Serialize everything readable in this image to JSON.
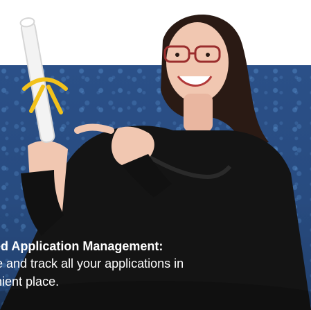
{
  "caption": {
    "title": "zed Application Management:",
    "body_line1": "e and track all your applications in",
    "body_line2": "venient place."
  },
  "photo": {
    "icon": "graduate-photo"
  },
  "colors": {
    "band": "#2a4f86",
    "text": "#ffffff",
    "gown": "#111111",
    "ribbon": "#f2c21b",
    "diploma": "#f3f3f3"
  }
}
